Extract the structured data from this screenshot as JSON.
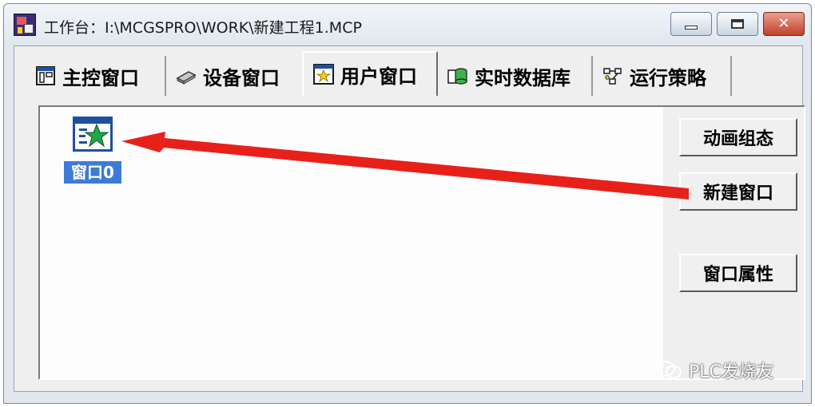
{
  "window": {
    "title": "工作台：I:\\MCGSPRO\\WORK\\新建工程1.MCP"
  },
  "tabs": [
    {
      "label": "主控窗口",
      "icon": "main-control-icon"
    },
    {
      "label": "设备窗口",
      "icon": "device-icon"
    },
    {
      "label": "用户窗口",
      "icon": "user-window-icon",
      "active": true
    },
    {
      "label": "实时数据库",
      "icon": "database-icon"
    },
    {
      "label": "运行策略",
      "icon": "strategy-icon"
    }
  ],
  "canvas": {
    "items": [
      {
        "label": "窗口0",
        "icon": "star-window-icon",
        "selected": true
      }
    ]
  },
  "side_buttons": {
    "animate": "动画组态",
    "new_window": "新建窗口",
    "properties": "窗口属性"
  },
  "watermark": {
    "text": "PLC发烧友"
  },
  "colors": {
    "selection": "#3d7bd6",
    "arrow": "#e8201a",
    "close_button": "#c0402a"
  }
}
